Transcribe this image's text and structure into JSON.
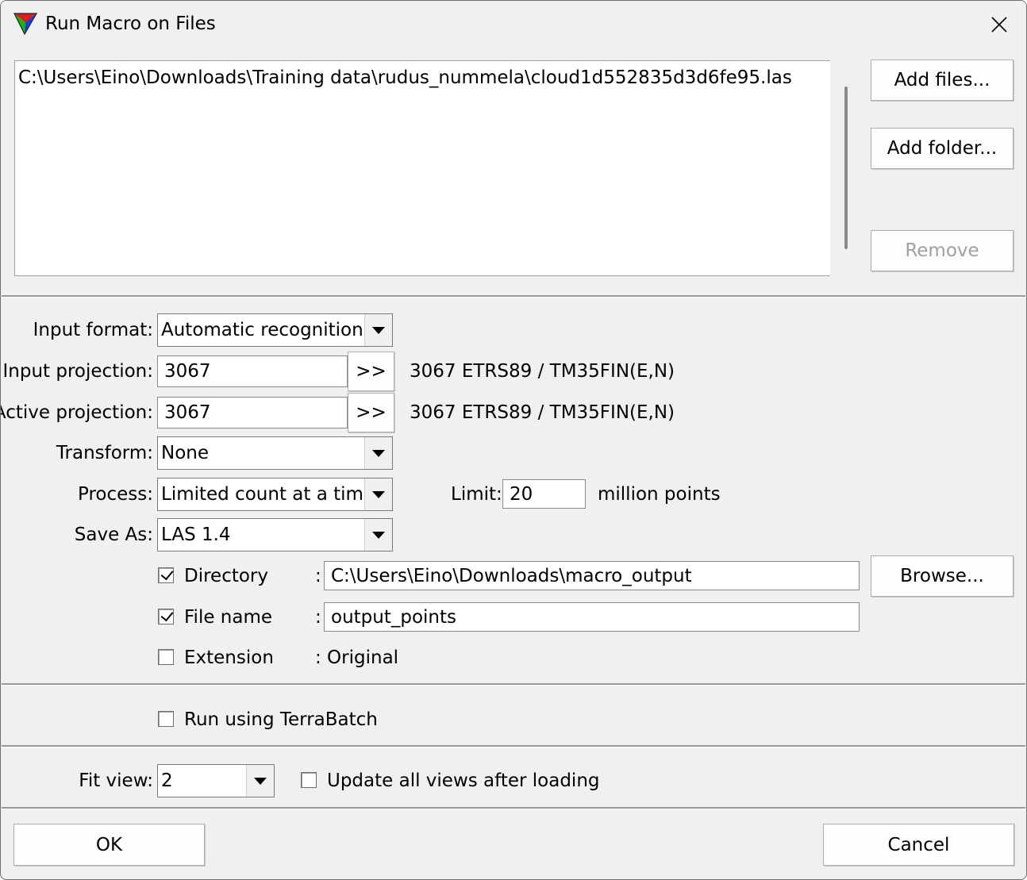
{
  "window": {
    "title": "Run Macro on Files"
  },
  "files": {
    "items": [
      "C:\\Users\\Eino\\Downloads\\Training data\\rudus_nummela\\cloud1d552835d3d6fe95.las"
    ],
    "add_files_label": "Add files...",
    "add_folder_label": "Add folder...",
    "remove_label": "Remove"
  },
  "settings": {
    "input_format": {
      "label": "Input format:",
      "value": "Automatic recognition"
    },
    "input_projection": {
      "label": "Input projection:",
      "value": "3067",
      "button": ">>",
      "description": "3067 ETRS89 / TM35FIN(E,N)"
    },
    "active_projection": {
      "label": "Active projection:",
      "value": "3067",
      "button": ">>",
      "description": "3067 ETRS89 / TM35FIN(E,N)"
    },
    "transform": {
      "label": "Transform:",
      "value": "None"
    },
    "process": {
      "label": "Process:",
      "value": "Limited count at a time",
      "limit_label": "Limit:",
      "limit_value": "20",
      "limit_unit": "million points"
    },
    "save_as": {
      "label": "Save As:",
      "value": "LAS 1.4"
    },
    "directory": {
      "label": "Directory",
      "checked": true,
      "separator": ":",
      "value": "C:\\Users\\Eino\\Downloads\\macro_output",
      "browse_label": "Browse..."
    },
    "file_name": {
      "label": "File name",
      "checked": true,
      "separator": ":",
      "value": "output_points"
    },
    "extension": {
      "label": "Extension",
      "checked": false,
      "value": ": Original"
    }
  },
  "terrabatch": {
    "label": "Run using TerraBatch",
    "checked": false
  },
  "view": {
    "fit_view_label": "Fit view:",
    "fit_view_value": "2",
    "update_all_label": "Update all views after loading",
    "update_all_checked": false
  },
  "footer": {
    "ok_label": "OK",
    "cancel_label": "Cancel"
  },
  "icons": {
    "app": "triangle-color-icon",
    "close": "close-icon",
    "dropdown": "chevron-down-icon",
    "check": "checkmark-icon"
  }
}
